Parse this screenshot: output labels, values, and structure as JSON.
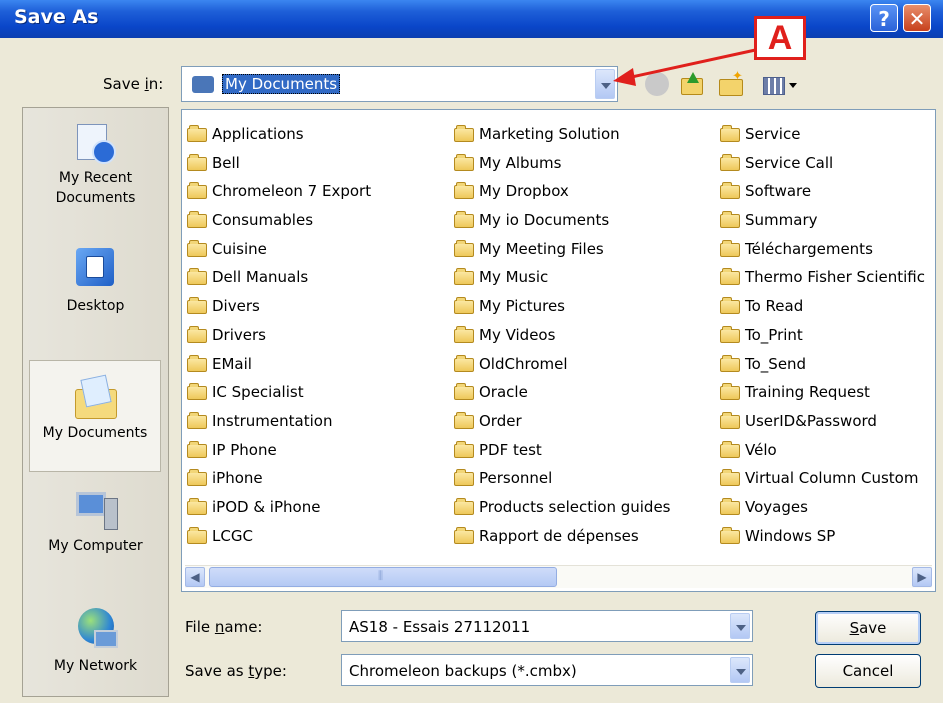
{
  "window": {
    "title": "Save As",
    "help_glyph": "?",
    "close_glyph": "✕"
  },
  "savein": {
    "label_pre": "Save ",
    "label_key": "i",
    "label_post": "n:",
    "value": "My Documents"
  },
  "annotation": {
    "label": "A",
    "color": "#e0201c"
  },
  "places": [
    {
      "label": "My Recent Documents",
      "icon": "recent-documents-icon"
    },
    {
      "label": "Desktop",
      "icon": "desktop-icon"
    },
    {
      "label": "My Documents",
      "icon": "my-documents-icon",
      "selected": true
    },
    {
      "label": "My Computer",
      "icon": "my-computer-icon"
    },
    {
      "label": "My Network",
      "icon": "my-network-icon"
    }
  ],
  "files": {
    "col1": [
      "Applications",
      "Bell",
      "Chromeleon 7 Export",
      "Consumables",
      "Cuisine",
      "Dell Manuals",
      "Divers",
      "Drivers",
      "EMail",
      "IC Specialist",
      "Instrumentation",
      "IP Phone",
      "iPhone",
      "iPOD & iPhone",
      "LCGC"
    ],
    "col2": [
      "Marketing Solution",
      "My Albums",
      "My Dropbox",
      "My io Documents",
      "My Meeting Files",
      "My Music",
      "My Pictures",
      "My Videos",
      "OldChromel",
      "Oracle",
      "Order",
      "PDF test",
      "Personnel",
      "Products selection guides",
      "Rapport de dépenses"
    ],
    "col3": [
      "Service",
      "Service Call",
      "Software",
      "Summary",
      "Téléchargements",
      "Thermo Fisher Scientific",
      "To Read",
      "To_Print",
      "To_Send",
      "Training Request",
      "UserID&Password",
      "Vélo",
      "Virtual Column Custom",
      "Voyages",
      "Windows SP"
    ]
  },
  "scrollbar": {
    "left_glyph": "◀",
    "right_glyph": "▶"
  },
  "filename": {
    "label_pre": "File ",
    "label_key": "n",
    "label_post": "ame:",
    "value": "AS18 - Essais 27112011"
  },
  "filetype": {
    "label_pre": "Save as ",
    "label_key": "t",
    "label_post": "ype:",
    "value": "Chromeleon backups (*.cmbx)"
  },
  "buttons": {
    "save_key": "S",
    "save_rest": "ave",
    "cancel": "Cancel"
  }
}
